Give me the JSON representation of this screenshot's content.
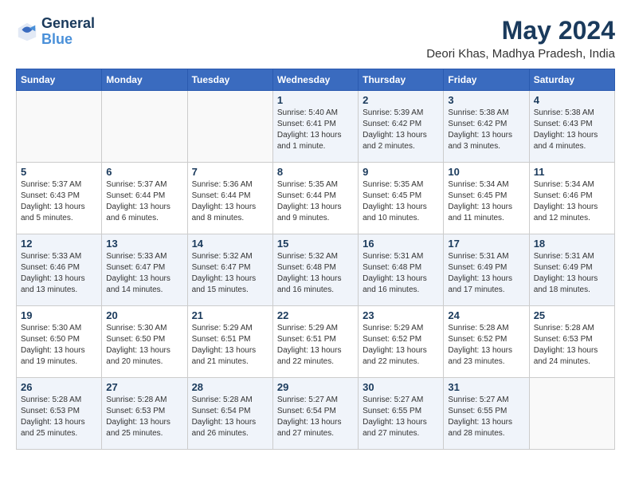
{
  "logo": {
    "line1": "General",
    "line2": "Blue"
  },
  "title": "May 2024",
  "subtitle": "Deori Khas, Madhya Pradesh, India",
  "days_header": [
    "Sunday",
    "Monday",
    "Tuesday",
    "Wednesday",
    "Thursday",
    "Friday",
    "Saturday"
  ],
  "weeks": [
    [
      {
        "day": "",
        "info": ""
      },
      {
        "day": "",
        "info": ""
      },
      {
        "day": "",
        "info": ""
      },
      {
        "day": "1",
        "info": "Sunrise: 5:40 AM\nSunset: 6:41 PM\nDaylight: 13 hours\nand 1 minute."
      },
      {
        "day": "2",
        "info": "Sunrise: 5:39 AM\nSunset: 6:42 PM\nDaylight: 13 hours\nand 2 minutes."
      },
      {
        "day": "3",
        "info": "Sunrise: 5:38 AM\nSunset: 6:42 PM\nDaylight: 13 hours\nand 3 minutes."
      },
      {
        "day": "4",
        "info": "Sunrise: 5:38 AM\nSunset: 6:43 PM\nDaylight: 13 hours\nand 4 minutes."
      }
    ],
    [
      {
        "day": "5",
        "info": "Sunrise: 5:37 AM\nSunset: 6:43 PM\nDaylight: 13 hours\nand 5 minutes."
      },
      {
        "day": "6",
        "info": "Sunrise: 5:37 AM\nSunset: 6:44 PM\nDaylight: 13 hours\nand 6 minutes."
      },
      {
        "day": "7",
        "info": "Sunrise: 5:36 AM\nSunset: 6:44 PM\nDaylight: 13 hours\nand 8 minutes."
      },
      {
        "day": "8",
        "info": "Sunrise: 5:35 AM\nSunset: 6:44 PM\nDaylight: 13 hours\nand 9 minutes."
      },
      {
        "day": "9",
        "info": "Sunrise: 5:35 AM\nSunset: 6:45 PM\nDaylight: 13 hours\nand 10 minutes."
      },
      {
        "day": "10",
        "info": "Sunrise: 5:34 AM\nSunset: 6:45 PM\nDaylight: 13 hours\nand 11 minutes."
      },
      {
        "day": "11",
        "info": "Sunrise: 5:34 AM\nSunset: 6:46 PM\nDaylight: 13 hours\nand 12 minutes."
      }
    ],
    [
      {
        "day": "12",
        "info": "Sunrise: 5:33 AM\nSunset: 6:46 PM\nDaylight: 13 hours\nand 13 minutes."
      },
      {
        "day": "13",
        "info": "Sunrise: 5:33 AM\nSunset: 6:47 PM\nDaylight: 13 hours\nand 14 minutes."
      },
      {
        "day": "14",
        "info": "Sunrise: 5:32 AM\nSunset: 6:47 PM\nDaylight: 13 hours\nand 15 minutes."
      },
      {
        "day": "15",
        "info": "Sunrise: 5:32 AM\nSunset: 6:48 PM\nDaylight: 13 hours\nand 16 minutes."
      },
      {
        "day": "16",
        "info": "Sunrise: 5:31 AM\nSunset: 6:48 PM\nDaylight: 13 hours\nand 16 minutes."
      },
      {
        "day": "17",
        "info": "Sunrise: 5:31 AM\nSunset: 6:49 PM\nDaylight: 13 hours\nand 17 minutes."
      },
      {
        "day": "18",
        "info": "Sunrise: 5:31 AM\nSunset: 6:49 PM\nDaylight: 13 hours\nand 18 minutes."
      }
    ],
    [
      {
        "day": "19",
        "info": "Sunrise: 5:30 AM\nSunset: 6:50 PM\nDaylight: 13 hours\nand 19 minutes."
      },
      {
        "day": "20",
        "info": "Sunrise: 5:30 AM\nSunset: 6:50 PM\nDaylight: 13 hours\nand 20 minutes."
      },
      {
        "day": "21",
        "info": "Sunrise: 5:29 AM\nSunset: 6:51 PM\nDaylight: 13 hours\nand 21 minutes."
      },
      {
        "day": "22",
        "info": "Sunrise: 5:29 AM\nSunset: 6:51 PM\nDaylight: 13 hours\nand 22 minutes."
      },
      {
        "day": "23",
        "info": "Sunrise: 5:29 AM\nSunset: 6:52 PM\nDaylight: 13 hours\nand 22 minutes."
      },
      {
        "day": "24",
        "info": "Sunrise: 5:28 AM\nSunset: 6:52 PM\nDaylight: 13 hours\nand 23 minutes."
      },
      {
        "day": "25",
        "info": "Sunrise: 5:28 AM\nSunset: 6:53 PM\nDaylight: 13 hours\nand 24 minutes."
      }
    ],
    [
      {
        "day": "26",
        "info": "Sunrise: 5:28 AM\nSunset: 6:53 PM\nDaylight: 13 hours\nand 25 minutes."
      },
      {
        "day": "27",
        "info": "Sunrise: 5:28 AM\nSunset: 6:53 PM\nDaylight: 13 hours\nand 25 minutes."
      },
      {
        "day": "28",
        "info": "Sunrise: 5:28 AM\nSunset: 6:54 PM\nDaylight: 13 hours\nand 26 minutes."
      },
      {
        "day": "29",
        "info": "Sunrise: 5:27 AM\nSunset: 6:54 PM\nDaylight: 13 hours\nand 27 minutes."
      },
      {
        "day": "30",
        "info": "Sunrise: 5:27 AM\nSunset: 6:55 PM\nDaylight: 13 hours\nand 27 minutes."
      },
      {
        "day": "31",
        "info": "Sunrise: 5:27 AM\nSunset: 6:55 PM\nDaylight: 13 hours\nand 28 minutes."
      },
      {
        "day": "",
        "info": ""
      }
    ]
  ]
}
